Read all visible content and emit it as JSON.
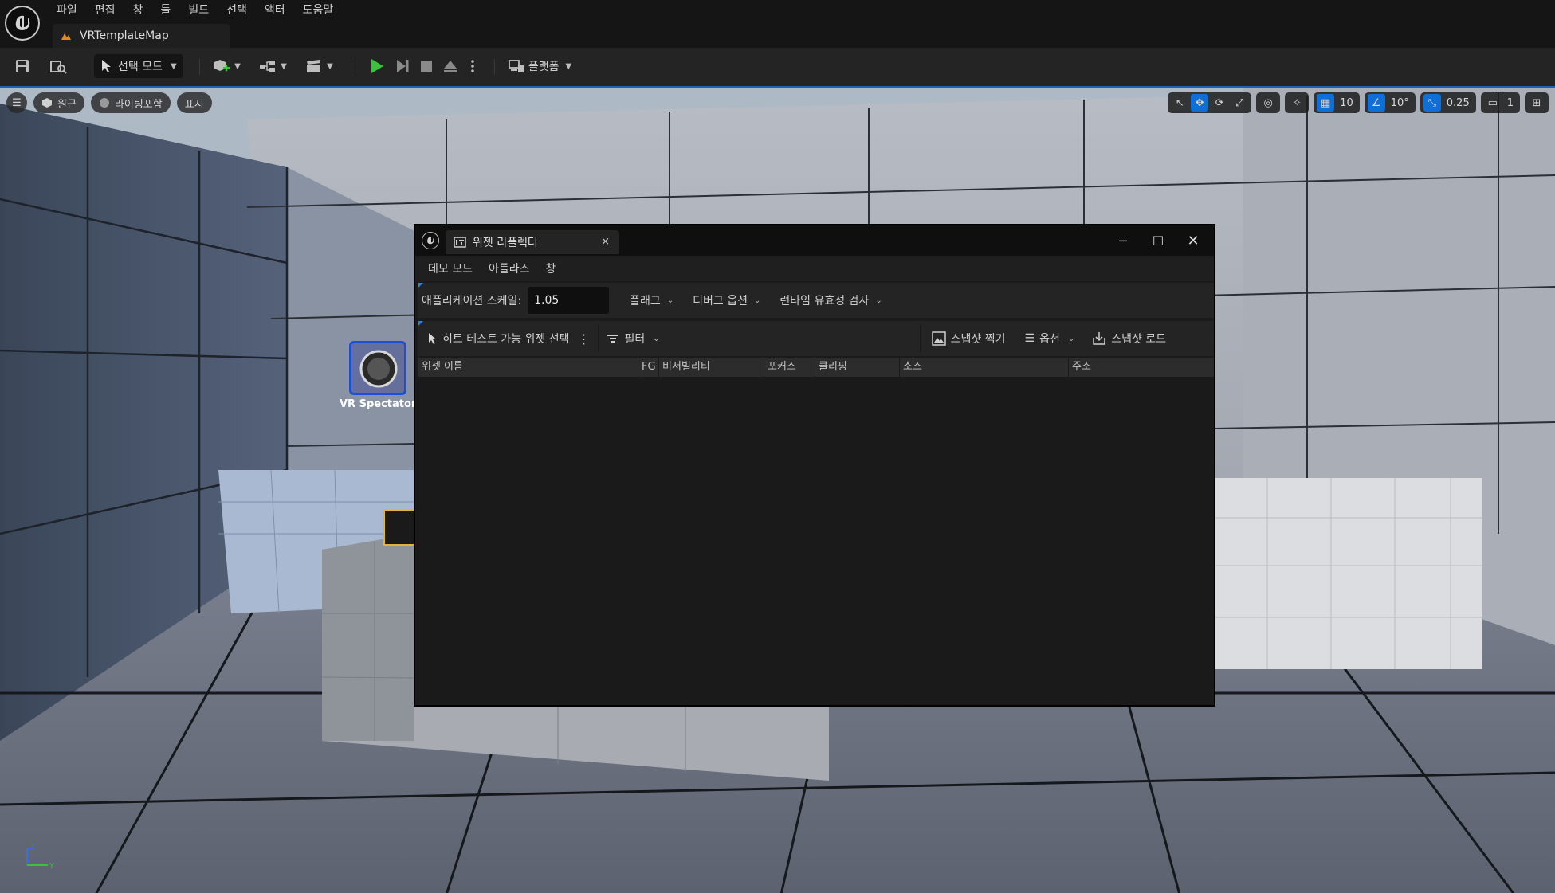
{
  "menubar": {
    "items": [
      "파일",
      "편집",
      "창",
      "툴",
      "빌드",
      "선택",
      "액터",
      "도움말"
    ]
  },
  "document_tab": {
    "label": "VRTemplateMap"
  },
  "toolbar": {
    "mode_label": "선택 모드",
    "platform_label": "플랫폼"
  },
  "viewport": {
    "perspective_label": "원근",
    "lighting_label": "라이팅포함",
    "show_label": "표시",
    "grid_snap_value": "10",
    "rotation_snap_value": "10°",
    "scale_snap_value": "0.25",
    "camera_speed_value": "1",
    "actor_label": "VR Spectator",
    "axis_z": "Z",
    "axis_y": "Y"
  },
  "widget_reflector": {
    "tab_title": "위젯 리플렉터",
    "menu": [
      "데모 모드",
      "아틀라스",
      "창"
    ],
    "app_scale_label": "애플리케이션 스케일:",
    "app_scale_value": "1.05",
    "flags_label": "플래그",
    "debug_options_label": "디버그 옵션",
    "runtime_check_label": "런타임 유효성 검사",
    "pick_hit_testable_label": "히트 테스트 가능 위젯 선택",
    "filter_label": "필터",
    "take_snapshot_label": "스냅샷 찍기",
    "options_label": "옵션",
    "load_snapshot_label": "스냅샷 로드",
    "columns": [
      "위젯 이름",
      "FG",
      "비저빌리티",
      "포커스",
      "클리핑",
      "소스",
      "주소"
    ]
  },
  "colors": {
    "accent": "#0f6fd6",
    "play_green": "#3fbf3f",
    "window_bg": "#1b1b1b"
  }
}
